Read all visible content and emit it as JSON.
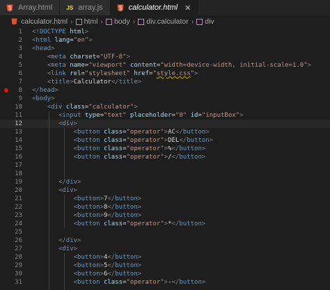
{
  "tabs": [
    {
      "label": "Array.html",
      "icon": "html5-icon",
      "active": false
    },
    {
      "label": "array.js",
      "icon": "js-icon",
      "active": false
    },
    {
      "label": "calculator.html",
      "icon": "html5-icon",
      "active": true
    }
  ],
  "breadcrumb": [
    "calculator.html",
    "html",
    "body",
    "div.calculator",
    "div"
  ],
  "editor": {
    "current_line": 12,
    "breakpoint_line": 8
  }
}
